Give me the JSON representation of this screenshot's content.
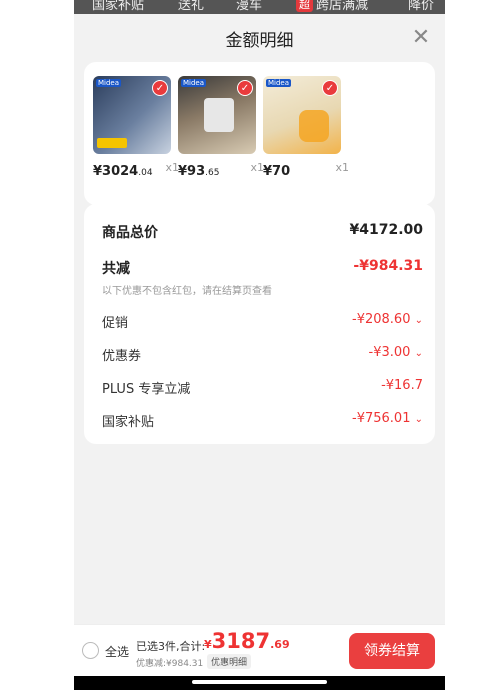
{
  "topbar": {
    "items": [
      "国家补贴",
      "送礼",
      "漫车",
      "跨店满减",
      "降价"
    ],
    "tag": "超"
  },
  "sheet": {
    "title": "金额明细",
    "close_icon": "close-icon"
  },
  "products": [
    {
      "price_int": "¥3024",
      "price_dec": ".04",
      "qty": "x1",
      "badge": "Midea",
      "colors": [
        "#2b3d5c",
        "#6a7f9f"
      ]
    },
    {
      "price_int": "¥93",
      "price_dec": ".65",
      "qty": "x1",
      "badge": "Midea",
      "colors": [
        "#5a4a3d",
        "#c9b89a"
      ]
    },
    {
      "price_int": "¥70",
      "price_dec": "",
      "qty": "x1",
      "badge": "Midea",
      "colors": [
        "#e9d9b8",
        "#f5a623"
      ]
    }
  ],
  "summary": {
    "total_label": "商品总价",
    "total_value": "¥4172.00",
    "reduce_label": "共减",
    "reduce_value": "-¥984.31",
    "hint": "以下优惠不包含红包，请在结算页查看",
    "items": [
      {
        "label": "促销",
        "value": "-¥208.60",
        "chevron": true
      },
      {
        "label": "优惠券",
        "value": "-¥3.00",
        "chevron": true
      },
      {
        "label": "PLUS 专享立减",
        "value": "-¥16.7",
        "chevron": false
      },
      {
        "label": "国家补贴",
        "value": "-¥756.01",
        "chevron": true
      }
    ]
  },
  "bottom": {
    "select_all": "全选",
    "selected_text": "已选3件,合计:",
    "total_yen": "¥",
    "total_int": "3187",
    "total_dec": ".69",
    "discount_text": "优惠减:¥984.31",
    "detail_button": "优惠明细",
    "pay_button": "领券结算"
  },
  "colors": {
    "accent": "#ea3f3f",
    "price_red": "#e33333"
  }
}
